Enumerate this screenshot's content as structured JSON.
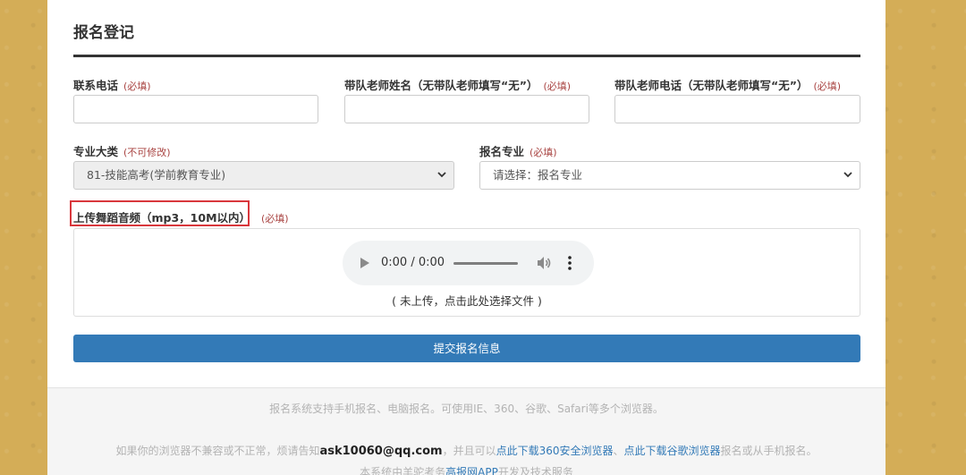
{
  "form": {
    "title": "报名登记",
    "required_tag": "(必填)",
    "locked_tag": "(不可修改)",
    "fields": {
      "phone_label": "联系电话",
      "teacher_name_label": "带队老师姓名（无带队老师填写“无”）",
      "teacher_phone_label": "带队老师电话（无带队老师填写“无”）",
      "major_category_label": "专业大类",
      "major_category_value": "81-技能高考(学前教育专业)",
      "major_label": "报名专业",
      "major_value": "请选择：报名专业",
      "audio_label": "上传舞蹈音频（mp3，10M以内）"
    },
    "audio": {
      "time": "0:00 / 0:00",
      "hint": "( 未上传，点击此处选择文件 )",
      "progress": 0
    },
    "submit_label": "提交报名信息"
  },
  "footer": {
    "line1": "报名系统支持手机报名、电脑报名。可使用IE、360、谷歌、Safari等多个浏览器。",
    "line2_prefix": "如果你的浏览器不兼容或不正常，烦请告知",
    "email": "ask10060@qq.com",
    "line2_mid": "，并且可以",
    "link_360": "点此下载360安全浏览器",
    "separator": "、",
    "link_chrome": "点此下载谷歌浏览器",
    "line2_suffix": "报名或从手机报名。",
    "line3_prefix": "本系统由羊驼考务",
    "line3_link": "高报网APP",
    "line3_suffix": "开发及技术服务"
  },
  "colors": {
    "background": "#d4ad57",
    "primary": "#337ab7",
    "required": "#a94442",
    "highlight": "#d9373c"
  },
  "icons": [
    "play-icon",
    "volume-icon",
    "more-vert-icon",
    "chevron-down-icon"
  ]
}
